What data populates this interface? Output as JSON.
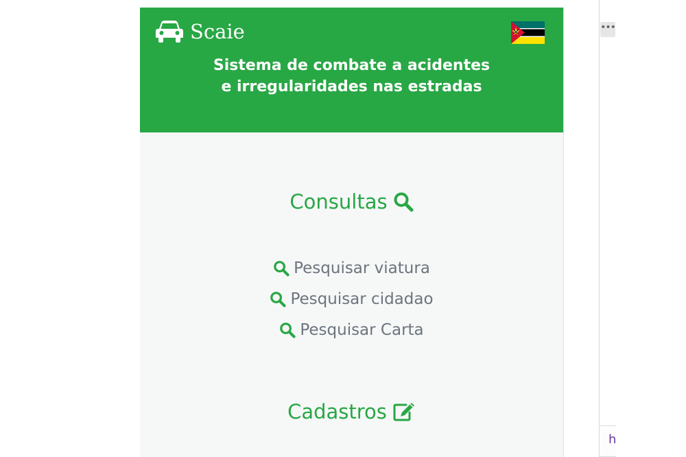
{
  "header": {
    "brand_name": "Scaie",
    "subtitle_line1": "Sistema de combate a acidentes",
    "subtitle_line2": "e irregularidades nas estradas",
    "background_color": "#28a745",
    "brand_icon": "car-icon",
    "flag_icon": "mozambique-flag-icon"
  },
  "consultas": {
    "title": "Consultas",
    "icon": "search-icon",
    "links": [
      {
        "label": "Pesquisar viatura",
        "icon": "search-icon"
      },
      {
        "label": "Pesquisar cidadao",
        "icon": "search-icon"
      },
      {
        "label": "Pesquisar Carta",
        "icon": "search-icon"
      }
    ]
  },
  "cadastros": {
    "title": "Cadastros",
    "icon": "edit-icon"
  },
  "chrome": {
    "more_label": "•••",
    "peek_text": "h"
  },
  "colors": {
    "accent": "#28a745",
    "link_text": "#6c757d",
    "panel_bg": "#f6f7f7"
  }
}
